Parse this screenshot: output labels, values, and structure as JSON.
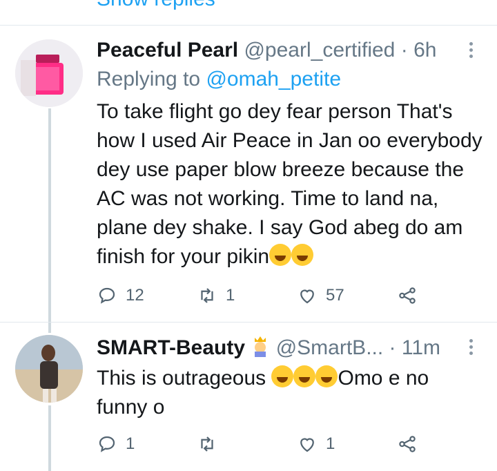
{
  "top": {
    "show_replies": "Show replies"
  },
  "tweets": [
    {
      "name": "Peaceful Pearl",
      "handle": "@pearl_certified",
      "separator": "·",
      "time": "6h",
      "replying_prefix": "Replying to",
      "replying_to": "@omah_petite",
      "text": "To take flight go dey fear person That's how I used Air Peace in Jan oo everybody dey use paper blow breeze because the AC was not working. Time to land na, plane dey shake. I say God abeg do am finish for your pikin",
      "replies": "12",
      "retweets": "1",
      "likes": "57"
    },
    {
      "name": "SMART-Beauty",
      "handle": "@SmartB...",
      "separator": "·",
      "time": "11m",
      "text_a": "This is outrageous",
      "text_b": "Omo e no funny o",
      "replies": "1",
      "retweets": "",
      "likes": "1"
    }
  ],
  "colors": {
    "accent": "#1da1f2",
    "muted": "#657786",
    "emoji": "#ffcc33"
  }
}
